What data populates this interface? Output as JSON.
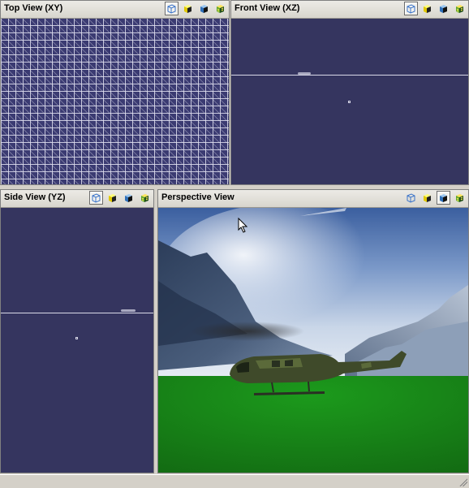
{
  "viewports": {
    "top": {
      "title": "Top View (XY)"
    },
    "front": {
      "title": "Front View (XZ)"
    },
    "side": {
      "title": "Side View (YZ)"
    },
    "persp": {
      "title": "Perspective View"
    }
  },
  "toolbar_icons": [
    "wireframe-cube-icon",
    "flat-shaded-cube-icon",
    "smooth-shaded-cube-icon",
    "textured-cube-icon"
  ],
  "active_mode": {
    "top": "wireframe",
    "front": "wireframe",
    "side": "wireframe",
    "persp": "smooth-shaded"
  },
  "colors": {
    "viewport_bg": "#35355f",
    "mesh_bg": "#3b3b72",
    "sky_top": "#3d63a6",
    "grass": "#1a8a1a",
    "chrome": "#d4d0c8"
  }
}
